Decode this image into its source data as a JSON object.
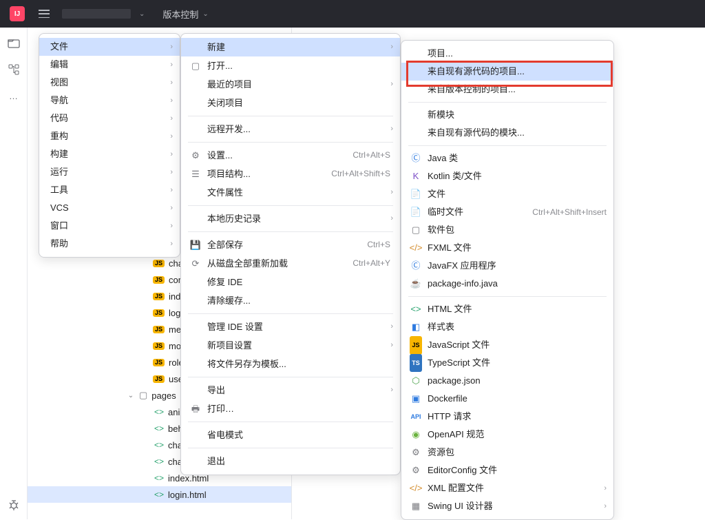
{
  "topbar": {
    "vcs": "版本控制"
  },
  "mainMenu": {
    "items": [
      {
        "label": "文件"
      },
      {
        "label": "编辑"
      },
      {
        "label": "视图"
      },
      {
        "label": "导航"
      },
      {
        "label": "代码"
      },
      {
        "label": "重构"
      },
      {
        "label": "构建"
      },
      {
        "label": "运行"
      },
      {
        "label": "工具"
      },
      {
        "label": "VCS"
      },
      {
        "label": "窗口"
      },
      {
        "label": "帮助"
      }
    ]
  },
  "fileMenu": {
    "new": "新建",
    "open": "打开...",
    "recent": "最近的项目",
    "close": "关闭项目",
    "remote": "远程开发...",
    "settings": "设置...",
    "settings_acc": "Ctrl+Alt+S",
    "structure": "项目结构...",
    "structure_acc": "Ctrl+Alt+Shift+S",
    "fileprops": "文件属性",
    "localhist": "本地历史记录",
    "saveall": "全部保存",
    "saveall_acc": "Ctrl+S",
    "reload": "从磁盘全部重新加载",
    "reload_acc": "Ctrl+Alt+Y",
    "repair": "修复 IDE",
    "clearCache": "清除缓存...",
    "manage": "管理 IDE 设置",
    "newproj": "新项目设置",
    "saveTmpl": "将文件另存为模板...",
    "export": "导出",
    "print": "打印…",
    "power": "省电模式",
    "exit": "退出"
  },
  "newMenu": {
    "project": "项目...",
    "fromSrc": "来自现有源代码的项目...",
    "fromVcs": "来自版本控制的项目...",
    "module": "新模块",
    "moduleSrc": "来自现有源代码的模块...",
    "javaClass": "Java 类",
    "kotlin": "Kotlin 类/文件",
    "file": "文件",
    "scratch": "临时文件",
    "scratch_acc": "Ctrl+Alt+Shift+Insert",
    "pkg": "软件包",
    "fxml": "FXML 文件",
    "javafx": "JavaFX 应用程序",
    "pkginfo": "package-info.java",
    "html": "HTML 文件",
    "css": "样式表",
    "js": "JavaScript 文件",
    "ts": "TypeScript 文件",
    "pkgjson": "package.json",
    "docker": "Dockerfile",
    "http": "HTTP 请求",
    "openapi": "OpenAPI 规范",
    "resbundle": "资源包",
    "editorconfig": "EditorConfig 文件",
    "xml": "XML 配置文件",
    "swing": "Swing UI 设计器"
  },
  "tree": {
    "jsFiles": [
      "cha",
      "com",
      "inde",
      "logi",
      "mer",
      "mor",
      "role",
      "use"
    ],
    "folder": "pages",
    "htmlFiles": [
      "anir",
      "beh",
      "cha",
      "chart_info.html",
      "index.html",
      "login.html"
    ]
  }
}
